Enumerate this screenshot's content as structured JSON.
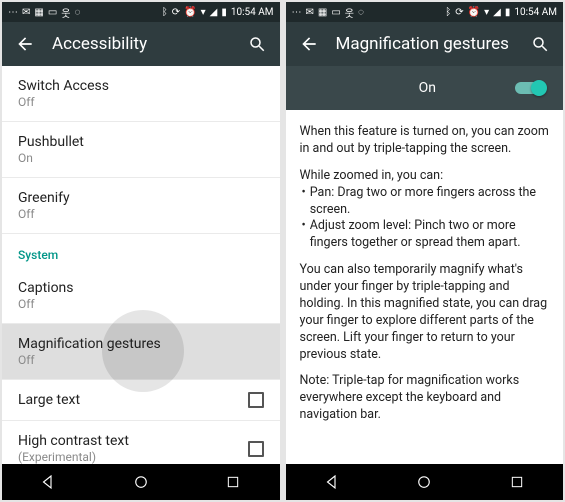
{
  "status": {
    "time": "10:54 AM",
    "left_icons": [
      "more",
      "mail",
      "calendar",
      "screen",
      "contacts",
      "chat"
    ],
    "right_icons": [
      "bluetooth",
      "sync",
      "alarm",
      "wifi",
      "signal",
      "battery"
    ]
  },
  "left": {
    "appbar_title": "Accessibility",
    "items": [
      {
        "title": "Switch Access",
        "sub": "Off"
      },
      {
        "title": "Pushbullet",
        "sub": "On"
      },
      {
        "title": "Greenify",
        "sub": "Off"
      }
    ],
    "section_label": "System",
    "system_items": [
      {
        "title": "Captions",
        "sub": "Off",
        "selected": false,
        "checkbox": false
      },
      {
        "title": "Magnification gestures",
        "sub": "Off",
        "selected": true,
        "checkbox": false
      },
      {
        "title": "Large text",
        "sub": "",
        "selected": false,
        "checkbox": true
      },
      {
        "title": "High contrast text",
        "sub": "(Experimental)",
        "selected": false,
        "checkbox": true
      }
    ]
  },
  "right": {
    "appbar_title": "Magnification gestures",
    "toggle_label": "On",
    "toggle_on": true,
    "paragraphs": {
      "intro": "When this feature is turned on, you can zoom in and out by triple-tapping the screen.",
      "zoom_heading": "While zoomed in, you can:",
      "bullets": [
        "Pan: Drag two or more fingers across the screen.",
        "Adjust zoom level: Pinch two or more fingers together or spread them apart."
      ],
      "temp": "You can also temporarily magnify what's under your finger by triple-tapping and holding. In this magnified state, you can drag your finger to explore different parts of the screen. Lift your finger to return to your previous state.",
      "note": "Note: Triple-tap for magnification works everywhere except the keyboard and navigation bar."
    }
  },
  "nav_buttons": [
    "back",
    "home",
    "recent"
  ]
}
